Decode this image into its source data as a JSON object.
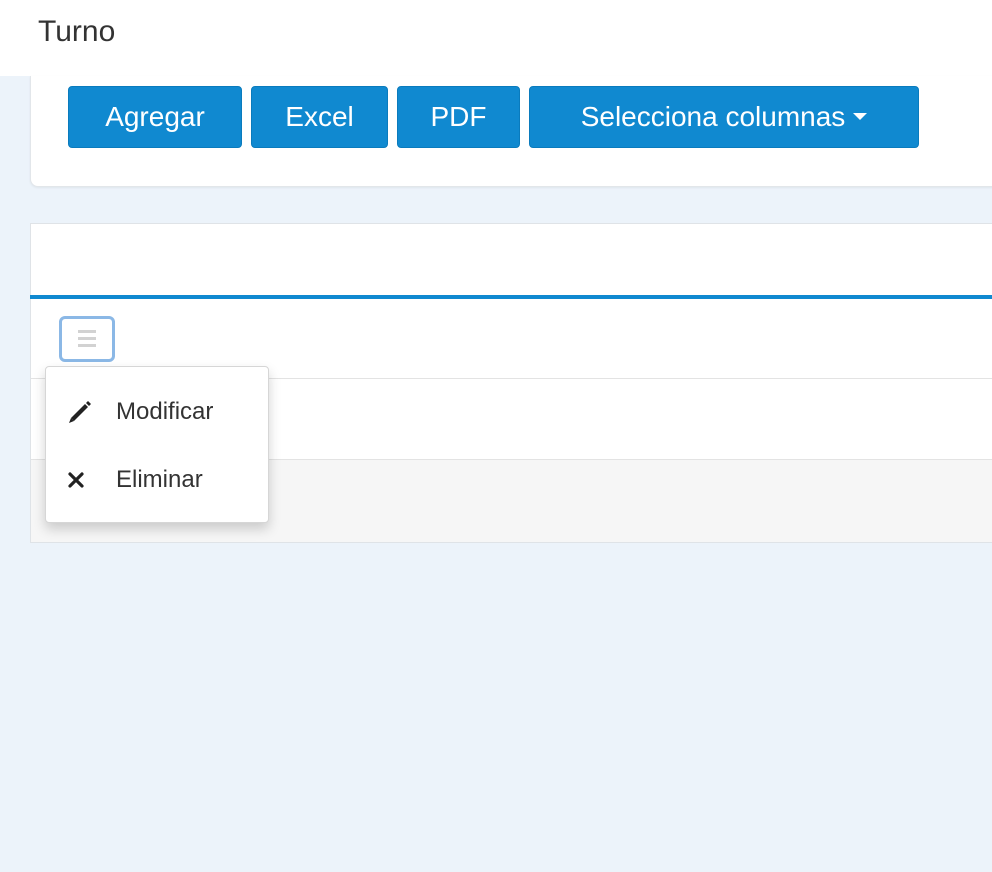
{
  "page": {
    "title": "Turno"
  },
  "toolbar": {
    "add_label": "Agregar",
    "excel_label": "Excel",
    "pdf_label": "PDF",
    "columns_label": "Selecciona columnas"
  },
  "row_menu": {
    "items": [
      {
        "label": "Modificar",
        "icon": "pencil-icon"
      },
      {
        "label": "Eliminar",
        "icon": "close-icon"
      }
    ]
  },
  "colors": {
    "accent": "#1089d0",
    "page_background": "#ecf3fa",
    "row_menu_button_border": "#8bb8e6"
  }
}
